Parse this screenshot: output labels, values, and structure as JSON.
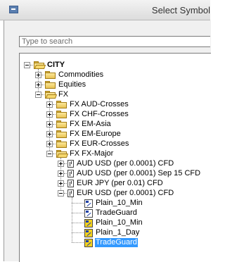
{
  "window": {
    "title": "Select Symbol",
    "icon": "app-window-icon"
  },
  "search": {
    "placeholder": "Type to search",
    "value": ""
  },
  "colors": {
    "selection": "#3399ff",
    "folder": "#e9c354",
    "template_highlight": "#f4d21d"
  },
  "tree": [
    {
      "label": "CITY",
      "level": 0,
      "expander": "minus",
      "icon": "folder-open-icon",
      "bold": true
    },
    {
      "label": "Commodities",
      "level": 1,
      "expander": "plus",
      "icon": "folder-icon"
    },
    {
      "label": "Equities",
      "level": 1,
      "expander": "plus",
      "icon": "folder-icon"
    },
    {
      "label": "FX",
      "level": 1,
      "expander": "minus",
      "icon": "folder-open-icon"
    },
    {
      "label": "FX AUD-Crosses",
      "level": 2,
      "expander": "plus",
      "icon": "folder-icon"
    },
    {
      "label": "FX CHF-Crosses",
      "level": 2,
      "expander": "plus",
      "icon": "folder-icon"
    },
    {
      "label": "FX EM-Asia",
      "level": 2,
      "expander": "plus",
      "icon": "folder-icon"
    },
    {
      "label": "FX EM-Europe",
      "level": 2,
      "expander": "plus",
      "icon": "folder-icon"
    },
    {
      "label": "FX EUR-Crosses",
      "level": 2,
      "expander": "plus",
      "icon": "folder-icon"
    },
    {
      "label": "FX FX-Major",
      "level": 2,
      "expander": "minus",
      "icon": "folder-open-icon"
    },
    {
      "label": "AUD USD (per 0.0001) CFD",
      "level": 3,
      "expander": "plus",
      "icon": "symbol-icon"
    },
    {
      "label": "AUD USD (per 0.0001) Sep 15 CFD",
      "level": 3,
      "expander": "plus",
      "icon": "symbol-icon"
    },
    {
      "label": "EUR JPY (per 0.01) CFD",
      "level": 3,
      "expander": "plus",
      "icon": "symbol-icon"
    },
    {
      "label": "EUR USD (per 0.0001) CFD",
      "level": 3,
      "expander": "minus",
      "icon": "symbol-icon"
    },
    {
      "label": "Plain_10_Min",
      "level": 4,
      "expander": "none",
      "icon": "template-icon"
    },
    {
      "label": "TradeGuard",
      "level": 4,
      "expander": "none",
      "icon": "template-icon"
    },
    {
      "label": "Plain_10_Min",
      "level": 4,
      "expander": "none",
      "icon": "template-highlight-icon"
    },
    {
      "label": "Plain_1_Day",
      "level": 4,
      "expander": "none",
      "icon": "template-highlight-icon"
    },
    {
      "label": "TradeGuard",
      "level": 4,
      "expander": "none",
      "icon": "template-highlight-icon",
      "selected": true
    }
  ]
}
